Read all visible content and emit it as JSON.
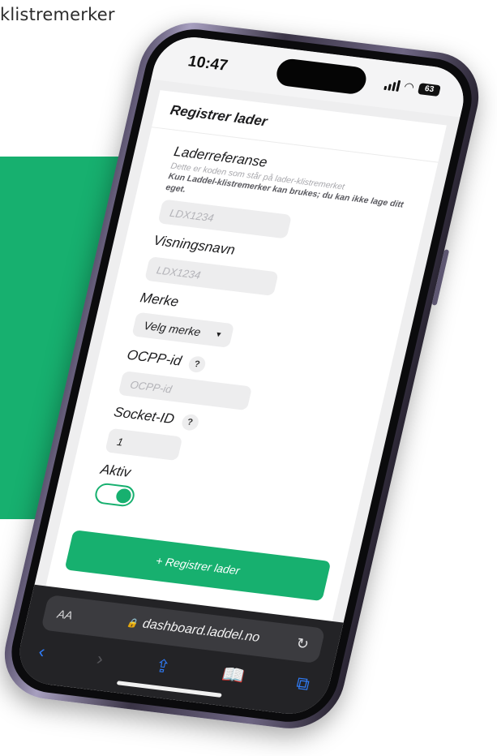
{
  "background_caption": "klistremerker",
  "colors": {
    "accent": "#17b06f",
    "browser_bar": "#232326",
    "nav_blue": "#2f7bf6"
  },
  "status_bar": {
    "time": "10:47",
    "battery": "63",
    "icons": [
      "signal-icon",
      "wifi-icon",
      "battery-icon"
    ]
  },
  "form": {
    "title": "Registrer lader",
    "charger_reference": {
      "label": "Laderreferanse",
      "helper": "Dette er koden som står på lader-klistremerket",
      "warning": "Kun Laddel-klistremerker kan brukes; du kan ikke lage ditt eget.",
      "placeholder": "LDX1234"
    },
    "display_name": {
      "label": "Visningsnavn",
      "placeholder": "LDX1234"
    },
    "brand": {
      "label": "Merke",
      "selected": "Velg merke"
    },
    "ocpp_id": {
      "label": "OCPP-id",
      "help": "?",
      "placeholder": "OCPP-id"
    },
    "socket_id": {
      "label": "Socket-ID",
      "help": "?",
      "value": "1"
    },
    "active": {
      "label": "Aktiv",
      "on": true
    },
    "submit_label": "+ Registrer lader"
  },
  "browser": {
    "text_size_label": "AA",
    "url": "dashboard.laddel.no",
    "nav_icons": [
      "back-icon",
      "forward-icon",
      "share-icon",
      "bookmarks-icon",
      "tabs-icon"
    ]
  }
}
